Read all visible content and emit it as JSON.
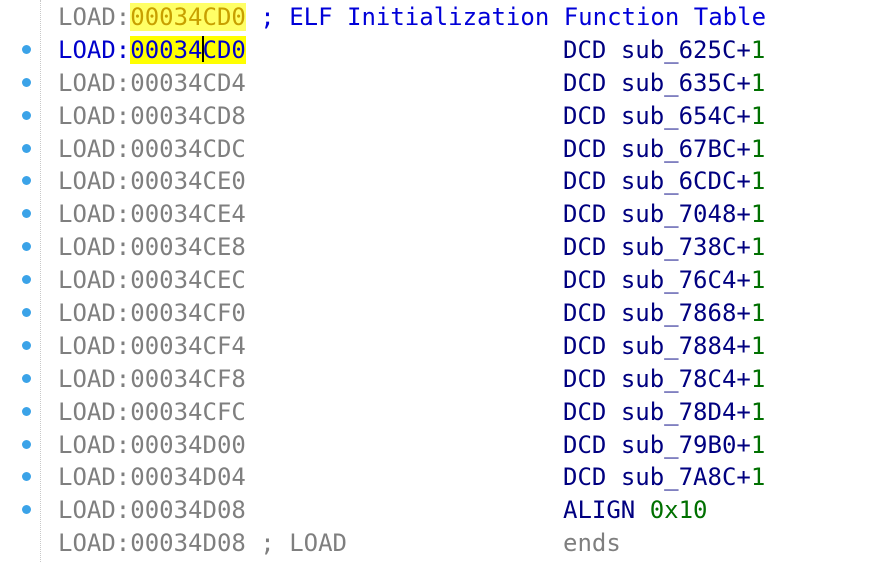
{
  "header": {
    "segment": "LOAD",
    "address": "00034CD0",
    "comment": "; ELF Initialization Function Table"
  },
  "current": {
    "segment": "LOAD",
    "address_hl_a": "00034",
    "address_hl_b": "CD0",
    "mnemonic": "DCD",
    "symbol": "sub_625C",
    "plus": "+",
    "num": "1"
  },
  "rows": [
    {
      "segment": "LOAD",
      "address": "00034CD4",
      "mnemonic": "DCD",
      "symbol": "sub_635C",
      "plus": "+",
      "num": "1"
    },
    {
      "segment": "LOAD",
      "address": "00034CD8",
      "mnemonic": "DCD",
      "symbol": "sub_654C",
      "plus": "+",
      "num": "1"
    },
    {
      "segment": "LOAD",
      "address": "00034CDC",
      "mnemonic": "DCD",
      "symbol": "sub_67BC",
      "plus": "+",
      "num": "1"
    },
    {
      "segment": "LOAD",
      "address": "00034CE0",
      "mnemonic": "DCD",
      "symbol": "sub_6CDC",
      "plus": "+",
      "num": "1"
    },
    {
      "segment": "LOAD",
      "address": "00034CE4",
      "mnemonic": "DCD",
      "symbol": "sub_7048",
      "plus": "+",
      "num": "1"
    },
    {
      "segment": "LOAD",
      "address": "00034CE8",
      "mnemonic": "DCD",
      "symbol": "sub_738C",
      "plus": "+",
      "num": "1"
    },
    {
      "segment": "LOAD",
      "address": "00034CEC",
      "mnemonic": "DCD",
      "symbol": "sub_76C4",
      "plus": "+",
      "num": "1"
    },
    {
      "segment": "LOAD",
      "address": "00034CF0",
      "mnemonic": "DCD",
      "symbol": "sub_7868",
      "plus": "+",
      "num": "1"
    },
    {
      "segment": "LOAD",
      "address": "00034CF4",
      "mnemonic": "DCD",
      "symbol": "sub_7884",
      "plus": "+",
      "num": "1"
    },
    {
      "segment": "LOAD",
      "address": "00034CF8",
      "mnemonic": "DCD",
      "symbol": "sub_78C4",
      "plus": "+",
      "num": "1"
    },
    {
      "segment": "LOAD",
      "address": "00034CFC",
      "mnemonic": "DCD",
      "symbol": "sub_78D4",
      "plus": "+",
      "num": "1"
    },
    {
      "segment": "LOAD",
      "address": "00034D00",
      "mnemonic": "DCD",
      "symbol": "sub_79B0",
      "plus": "+",
      "num": "1"
    },
    {
      "segment": "LOAD",
      "address": "00034D04",
      "mnemonic": "DCD",
      "symbol": "sub_7A8C",
      "plus": "+",
      "num": "1"
    }
  ],
  "align_row": {
    "segment": "LOAD",
    "address": "00034D08",
    "mnemonic": "ALIGN",
    "num": "0x10"
  },
  "ends_row": {
    "segment": "LOAD",
    "address": "00034D08",
    "comment": "; LOAD",
    "keyword": "ends"
  },
  "colors": {
    "address_gray": "#7f7f7f",
    "current_blue": "#0000cc",
    "highlight_yellow": "#ffff00",
    "code_navy": "#000080",
    "number_green": "#007000",
    "gutter_dot": "#3ba3e8"
  }
}
